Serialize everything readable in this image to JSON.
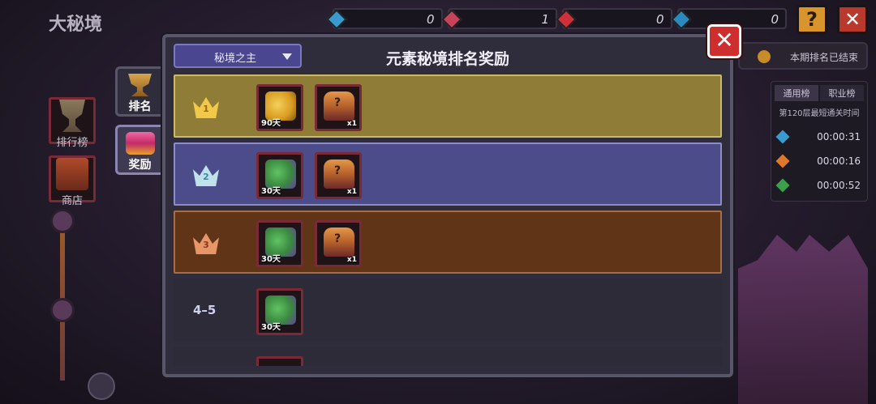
{
  "background": {
    "page_title": "大秘境",
    "resources": [
      {
        "name": "blue-gem",
        "value": "0",
        "color": "#3a9ad0"
      },
      {
        "name": "red-gem",
        "value": "1",
        "color": "#c8425a"
      },
      {
        "name": "red-gem-2",
        "value": "0",
        "color": "#d0303a"
      },
      {
        "name": "blue-gem-2",
        "value": "0",
        "color": "#2a8ac0"
      }
    ],
    "help_label": "?",
    "close_label": "✕",
    "side_nav": [
      {
        "label": "排行榜",
        "icon": "trophy-icon"
      },
      {
        "label": "商店",
        "icon": "shop-icon"
      }
    ],
    "season_status": "本期排名已结束",
    "rank_panel": {
      "tabs": [
        "通用榜",
        "职业榜"
      ],
      "caption": "第120层最短通关时间",
      "rows": [
        {
          "gem": "blue-crystal-icon",
          "color": "#3a9ad0",
          "time": "00:00:31"
        },
        {
          "gem": "fire-icon",
          "color": "#e0782a",
          "time": "00:00:16"
        },
        {
          "gem": "green-crystal-icon",
          "color": "#3aa04a",
          "time": "00:00:52"
        }
      ]
    }
  },
  "modal": {
    "title": "元素秘境排名奖励",
    "dropdown_value": "秘境之主",
    "close_label": "✕",
    "left_tabs": [
      {
        "label": "排名",
        "icon": "trophy-icon"
      },
      {
        "label": "奖励",
        "icon": "chest-icon"
      }
    ],
    "rows": [
      {
        "rank": "1",
        "style": "gold",
        "rewards": [
          {
            "art": "frog-gold",
            "tag": "90天"
          },
          {
            "art": "chest",
            "qty": "x1"
          }
        ]
      },
      {
        "rank": "2",
        "style": "silver",
        "rewards": [
          {
            "art": "frog-green",
            "tag": "30天"
          },
          {
            "art": "chest",
            "qty": "x1"
          }
        ]
      },
      {
        "rank": "3",
        "style": "bronze",
        "rewards": [
          {
            "art": "frog-green",
            "tag": "30天"
          },
          {
            "art": "chest",
            "qty": "x1"
          }
        ]
      },
      {
        "rank": "4–5",
        "style": "plain",
        "rewards": [
          {
            "art": "frog-green",
            "tag": "30天"
          }
        ]
      }
    ]
  }
}
